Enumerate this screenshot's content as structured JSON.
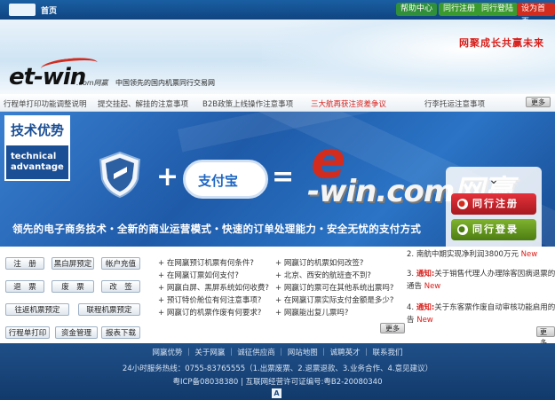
{
  "topbar": {
    "home": "首页",
    "buttons": [
      "帮助中心",
      "同行注册",
      "同行登陆",
      "设为首页"
    ]
  },
  "header": {
    "slogan": "网聚成长共赢未来",
    "logo": "et-win",
    "logo_sub": ".com网赢",
    "tagline": "中国领先的国内机票同行交易网"
  },
  "news": {
    "items": [
      "行程单打印功能调整说明",
      "提交挂起、解挂的注意事项",
      "B2B政策上线操作注意事项",
      "三大航再获注资差争议",
      "行李托运注意事项"
    ],
    "more": "更多"
  },
  "banner": {
    "tech_cn": "技术优势",
    "tech_en_1": "technical",
    "tech_en_2": "advantage",
    "alipay": "支付宝",
    "brand_e": "e",
    "brand": "-win.com网赢",
    "slogan": "领先的电子商务技术・全新的商业运营模式・快速的订单处理能力・安全无忧的支付方式",
    "agent_register": "同行注册",
    "agent_login": "同行登录"
  },
  "quick": {
    "row1": [
      "注　册",
      "黑白屏预定",
      "帐户充值"
    ],
    "row2": [
      "退　票",
      "废　票",
      "改　签"
    ],
    "row3": [
      "往返机票预定",
      "联程机票预定"
    ],
    "row4": [
      "行程单打印",
      "资金管理",
      "报表下载"
    ]
  },
  "faq": {
    "col1": [
      "+ 在网赢预订机票有何条件?",
      "+ 在网赢订票如何支付?",
      "+ 网赢白屏、黑屏系统如何收费?",
      "+ 预订特价舱位有何注意事项?",
      "+ 网赢订的机票作废有何要求?"
    ],
    "col2": [
      "+ 网赢订的机票如何改签?",
      "+ 北京、西安的航班查不到?",
      "+ 网赢订的票可在其他系统出票吗?",
      "+ 在网赢订票实际支付金额是多少?",
      "+ 网赢能出复儿票吗?"
    ],
    "more": "更多"
  },
  "notices": {
    "n2_num": "2.",
    "n2": "南航中期实现净利润3800万元",
    "n2_new": "New",
    "n3_num": "3.",
    "n3_tag": "通知:",
    "n3": "关于销售代理人办理除客因病退票的",
    "n3_b": "通告",
    "n3_new": "New",
    "n4_num": "4.",
    "n4_tag": "通知:",
    "n4": "关于东客票作废自动审核功能启用的通",
    "n4_b": "告",
    "n4_new": "New",
    "more": "更多"
  },
  "footer": {
    "links": "网赢优势 ｜ 关于网赢 ｜ 诚征供应商 ｜ 网站地图 ｜ 诚聘英才 ｜ 联系我们",
    "hotline": "24小时服务热线：0755-83765555（1.出票废票、2.退票退款、3.业务合作、4.意见建议）",
    "icp": "粤ICP备08038380 | 互联网经营许可证编号:粤B2-20080340",
    "icon": "A"
  }
}
